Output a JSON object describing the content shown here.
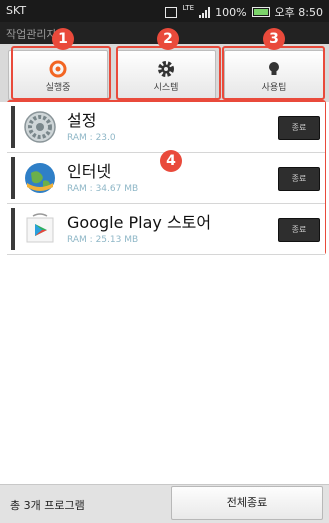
{
  "status_bar": {
    "carrier": "SKT",
    "network": "LTE",
    "battery": "100%",
    "time": "오후 8:50"
  },
  "title_bar": {
    "title": "작업관리자"
  },
  "tabs": [
    {
      "label": "실행중",
      "icon": "power-icon",
      "badge": "1"
    },
    {
      "label": "시스템",
      "icon": "gear-icon",
      "badge": "2"
    },
    {
      "label": "사용팁",
      "icon": "lightbulb-icon",
      "badge": "3"
    }
  ],
  "list_badge": "4",
  "apps": [
    {
      "name": "설정",
      "ram": "RAM : 23.0",
      "end_label": "종료",
      "icon": "settings-app-icon"
    },
    {
      "name": "인터넷",
      "ram": "RAM : 34.67 MB",
      "end_label": "종료",
      "icon": "internet-globe-icon"
    },
    {
      "name": "Google Play 스토어",
      "ram": "RAM : 25.13 MB",
      "end_label": "종료",
      "icon": "google-play-icon"
    }
  ],
  "footer": {
    "count_text": "총 3개 프로그램",
    "end_all_label": "전체종료"
  },
  "colors": {
    "highlight": "#e94a3b",
    "tab_active_icon": "#f26522",
    "ram_text": "#8fb7c7"
  }
}
